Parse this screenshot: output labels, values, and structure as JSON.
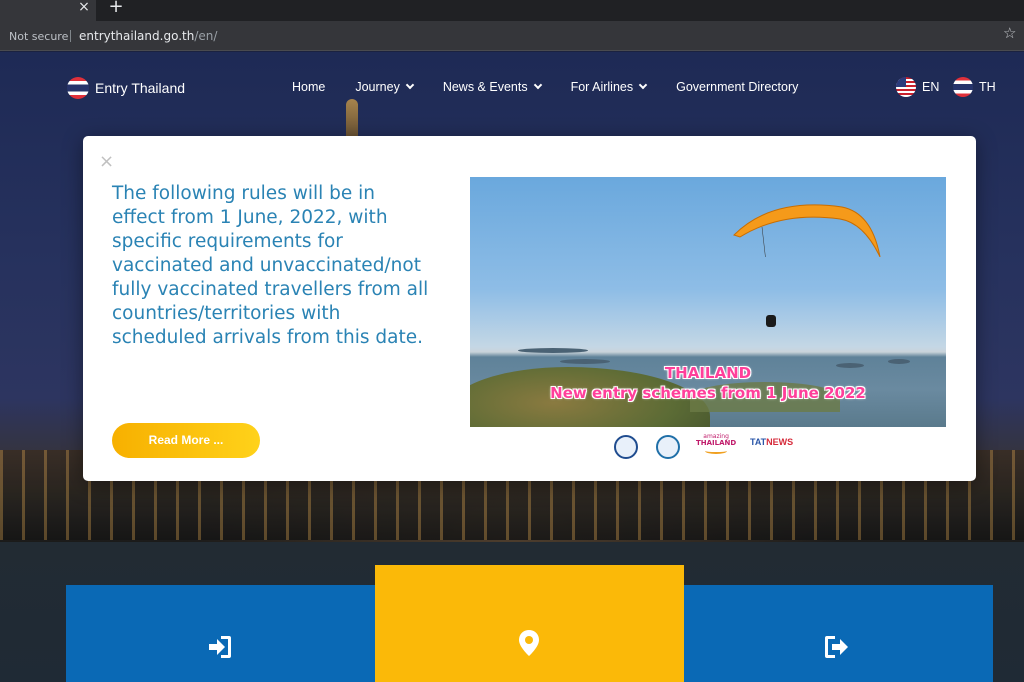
{
  "browser": {
    "tab_close": "×",
    "new_tab": "+",
    "security_label": "Not secure",
    "url_domain": "entrythailand.go.th",
    "url_path": "/en/",
    "bookmark_icon": "star-icon"
  },
  "header": {
    "logo_text": "Entry Thailand",
    "nav": [
      {
        "label": "Home",
        "has_dropdown": false
      },
      {
        "label": "Journey",
        "has_dropdown": true
      },
      {
        "label": "News & Events",
        "has_dropdown": true
      },
      {
        "label": "For Airlines",
        "has_dropdown": true
      },
      {
        "label": "Government Directory",
        "has_dropdown": false
      }
    ],
    "languages": [
      {
        "code": "EN",
        "flag": "us-flag-icon"
      },
      {
        "code": "TH",
        "flag": "thai-flag-icon"
      }
    ]
  },
  "modal": {
    "close": "×",
    "text": "The following rules will be in effect from 1 June, 2022, with specific requirements for vaccinated and unvaccinated/not fully vaccinated travellers from all countries/territories with scheduled arrivals from this date.",
    "button_label": "Read More ...",
    "promo": {
      "headline_1": "THAILAND",
      "headline_2": "New entry schemes from 1 June 2022",
      "partner_logos": [
        "ministry-seal-icon",
        "ministry-emblem-icon",
        "amazing-thailand-logo",
        "tat-news-logo"
      ],
      "amazing_small": "amazing",
      "amazing_big": "THAILAND",
      "tat": "TAT",
      "tat_news": "NEWS"
    }
  },
  "tiles": [
    {
      "icon": "sign-in-icon",
      "color": "#0a69b5"
    },
    {
      "icon": "map-pin-icon",
      "color": "#fbb908"
    },
    {
      "icon": "sign-out-icon",
      "color": "#0a69b5"
    }
  ],
  "colors": {
    "modal_text": "#2a83b4",
    "button": "#fbb908",
    "headline": "#ff3f9a"
  }
}
